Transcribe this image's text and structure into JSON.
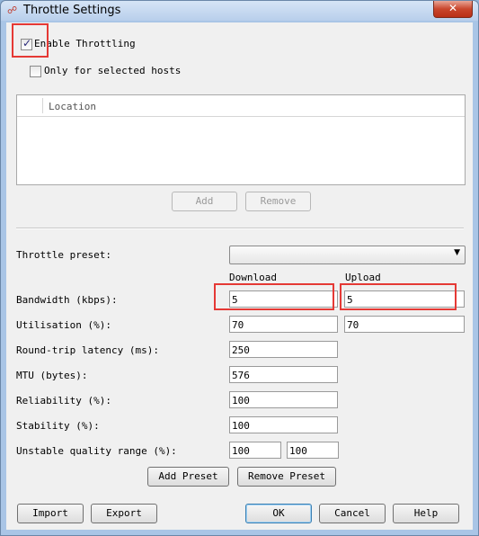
{
  "window": {
    "title": "Throttle Settings",
    "close_glyph": "✕"
  },
  "enable_throttling": {
    "label": "Enable Throttling",
    "checked": true
  },
  "only_selected_hosts": {
    "label": "Only for selected hosts",
    "checked": false
  },
  "hosts_table": {
    "columns": [
      "Location"
    ],
    "rows": []
  },
  "hosts_buttons": {
    "add": "Add",
    "remove": "Remove"
  },
  "preset": {
    "label": "Throttle preset:",
    "selected": ""
  },
  "columns": {
    "download": "Download",
    "upload": "Upload"
  },
  "settings": {
    "bandwidth": {
      "label": "Bandwidth (kbps):",
      "download": "5",
      "upload": "5"
    },
    "utilisation": {
      "label": "Utilisation (%):",
      "download": "70",
      "upload": "70"
    },
    "latency": {
      "label": "Round-trip latency (ms):",
      "value": "250"
    },
    "mtu": {
      "label": "MTU (bytes):",
      "value": "576"
    },
    "reliability": {
      "label": "Reliability (%):",
      "value": "100"
    },
    "stability": {
      "label": "Stability (%):",
      "value": "100"
    },
    "unstable_range": {
      "label": "Unstable quality range (%):",
      "min": "100",
      "max": "100"
    }
  },
  "preset_buttons": {
    "add": "Add Preset",
    "remove": "Remove Preset"
  },
  "footer_buttons": {
    "import": "Import",
    "export": "Export",
    "ok": "OK",
    "cancel": "Cancel",
    "help": "Help"
  },
  "colors": {
    "highlight": "#e53935",
    "titlebar": "#b8cfeb",
    "close": "#c9462c"
  }
}
